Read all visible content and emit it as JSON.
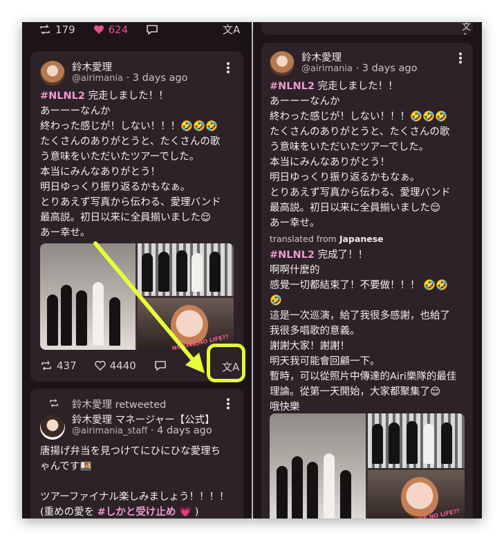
{
  "left_column": {
    "top_actions": {
      "retweets": "179",
      "likes": "624"
    },
    "post": {
      "author": "鈴木愛理",
      "handle": "@airimania",
      "time": "· 3 days ago",
      "hashtag": "#NLNL2",
      "text_after_hashtag": " 完走しました！！",
      "body": "あーーーなんか\n終わった感じが！しない！！！🤣🤣🤣\nたくさんのありがとうと、たくさんの歌\nう意味をいただいたツアーでした。\n本当にみんなありがとう！\n明日ゆっくり振り返るかもなぁ。\nとりあえず写真から伝わる、愛理バンド\n最高説。初日以来に全員揃いました😌\nあー幸せ。",
      "retweets": "437",
      "likes": "4440"
    },
    "retweet_post": {
      "retweeted_by": "鈴木愛理 retweeted",
      "author": "鈴木愛理 マネージャー【公式】",
      "handle": "@airimania_staff",
      "time": "· 4 days ago",
      "line1": "唐揚げ弁当を見つけてにひにひな愛理ち",
      "line2": "ゃんです🍱",
      "line3": "ツアーファイナル楽しみましょう！！！！",
      "line4_prefix": "(重めの愛を ",
      "line4_hashtag": "#しかと受け止め",
      "line4_suffix": " 💗 )"
    }
  },
  "right_column": {
    "post": {
      "author": "鈴木愛理",
      "handle": "@airimania",
      "time": "· 3 days ago",
      "hashtag": "#NLNL2",
      "text_after_hashtag": " 完走しました！！",
      "body": "あーーーなんか\n終わった感じが！しない！！！🤣🤣🤣\nたくさんのありがとうと、たくさんの歌\nう意味をいただいたツアーでした。\n本当にみんなありがとう！\n明日ゆっくり振り返るかもなぁ。\nとりあえず写真から伝わる、愛理バンド\n最高説。初日以来に全員揃いました😌\nあー幸せ。",
      "translated_prefix": "translated from ",
      "translated_lang": "Japanese",
      "tr_hashtag": "#NLNL2",
      "tr_after_hashtag": " 完成了！！",
      "tr_body": "啊啊什麼的\n感覺一切都結束了！不要做！！！ 🤣🤣\n🤣\n這是一次巡演，給了我很多感謝，也給了\n我很多唱歌的意義。\n謝謝大家！謝謝！\n明天我可能會回顧一下。\n暫時，可以從照片中傳達的Airi樂隊的最佳\n理論。從第一天開始，大家都聚集了😌\n哦快樂"
    }
  },
  "photo_sticker": "NO LIVE,NO LIFE??",
  "colors": {
    "background": "#1d1419",
    "card": "#2c2228",
    "hashtag": "#f19ad0",
    "like_pink": "#e0528e",
    "highlight": "#e8ff3a"
  },
  "icons": [
    "retweet-icon",
    "heart-icon",
    "reply-icon",
    "translate-icon",
    "more-icon"
  ]
}
